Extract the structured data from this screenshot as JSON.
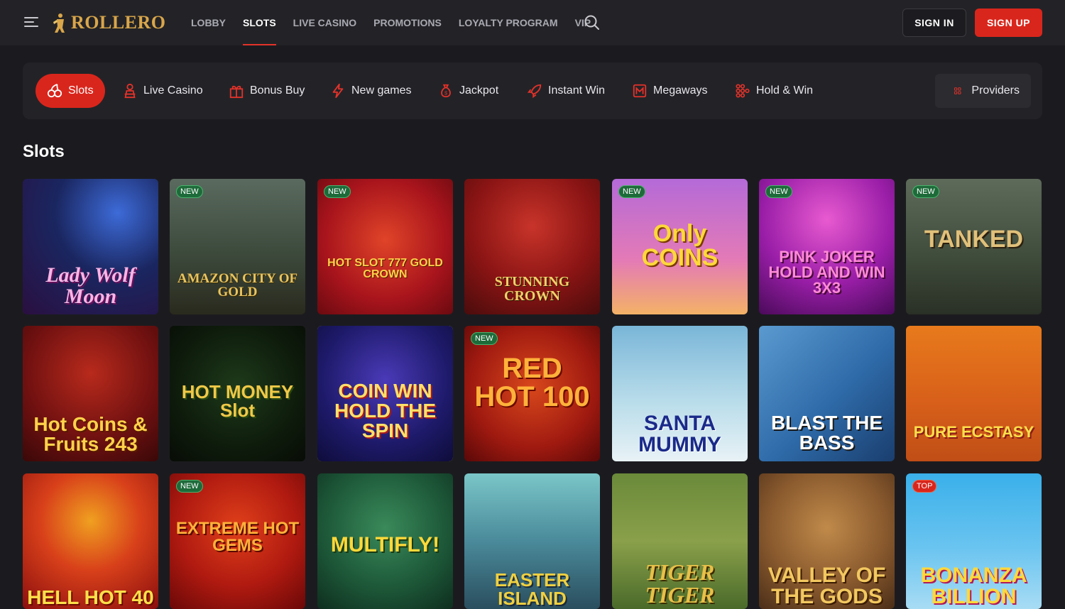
{
  "header": {
    "logo_text": "ROLLERO",
    "nav": [
      {
        "label": "LOBBY",
        "active": false
      },
      {
        "label": "SLOTS",
        "active": true
      },
      {
        "label": "LIVE CASINO",
        "active": false
      },
      {
        "label": "PROMOTIONS",
        "active": false
      },
      {
        "label": "LOYALTY PROGRAM",
        "active": false
      },
      {
        "label": "VIP",
        "active": false
      }
    ],
    "sign_in": "SIGN IN",
    "sign_up": "SIGN UP"
  },
  "categories": [
    {
      "label": "Slots",
      "icon": "cherries-icon",
      "active": true
    },
    {
      "label": "Live Casino",
      "icon": "dealer-icon",
      "active": false
    },
    {
      "label": "Bonus Buy",
      "icon": "gift-icon",
      "active": false
    },
    {
      "label": "New games",
      "icon": "lightning-icon",
      "active": false
    },
    {
      "label": "Jackpot",
      "icon": "money-bag-icon",
      "active": false
    },
    {
      "label": "Instant Win",
      "icon": "rocket-icon",
      "active": false
    },
    {
      "label": "Megaways",
      "icon": "megaways-icon",
      "active": false
    },
    {
      "label": "Hold & Win",
      "icon": "grid-dots-icon",
      "active": false
    }
  ],
  "providers_label": "Providers",
  "section_title": "Slots",
  "games": [
    {
      "title": "Lady Wolf Moon",
      "badge": ""
    },
    {
      "title": "AMAZON CITY OF GOLD",
      "badge": "NEW"
    },
    {
      "title": "HOT SLOT 777 GOLD CROWN",
      "badge": "NEW"
    },
    {
      "title": "STUNNING CROWN",
      "badge": ""
    },
    {
      "title": "Only COINS",
      "badge": "NEW"
    },
    {
      "title": "PINK JOKER HOLD AND WIN 3X3",
      "badge": "NEW"
    },
    {
      "title": "TANKED",
      "badge": "NEW"
    },
    {
      "title": "Hot Coins & Fruits 243",
      "badge": ""
    },
    {
      "title": "HOT MONEY Slot",
      "badge": ""
    },
    {
      "title": "COIN WIN HOLD THE SPIN",
      "badge": ""
    },
    {
      "title": "RED HOT 100",
      "badge": "NEW"
    },
    {
      "title": "SANTA MUMMY",
      "badge": ""
    },
    {
      "title": "BLAST THE BASS",
      "badge": ""
    },
    {
      "title": "PURE ECSTASY",
      "badge": ""
    },
    {
      "title": "HELL HOT 40",
      "badge": ""
    },
    {
      "title": "EXTREME HOT GEMS",
      "badge": "NEW"
    },
    {
      "title": "MULTIFLY!",
      "badge": ""
    },
    {
      "title": "EASTER ISLAND",
      "badge": ""
    },
    {
      "title": "TIGER TIGER",
      "badge": ""
    },
    {
      "title": "VALLEY OF THE GODS",
      "badge": ""
    },
    {
      "title": "BONANZA BILLION",
      "badge": "TOP"
    }
  ],
  "colors": {
    "accent": "#d9261c",
    "header_bg": "#232327",
    "page_bg": "#1b1b1f",
    "gold": "#d9a64a"
  }
}
